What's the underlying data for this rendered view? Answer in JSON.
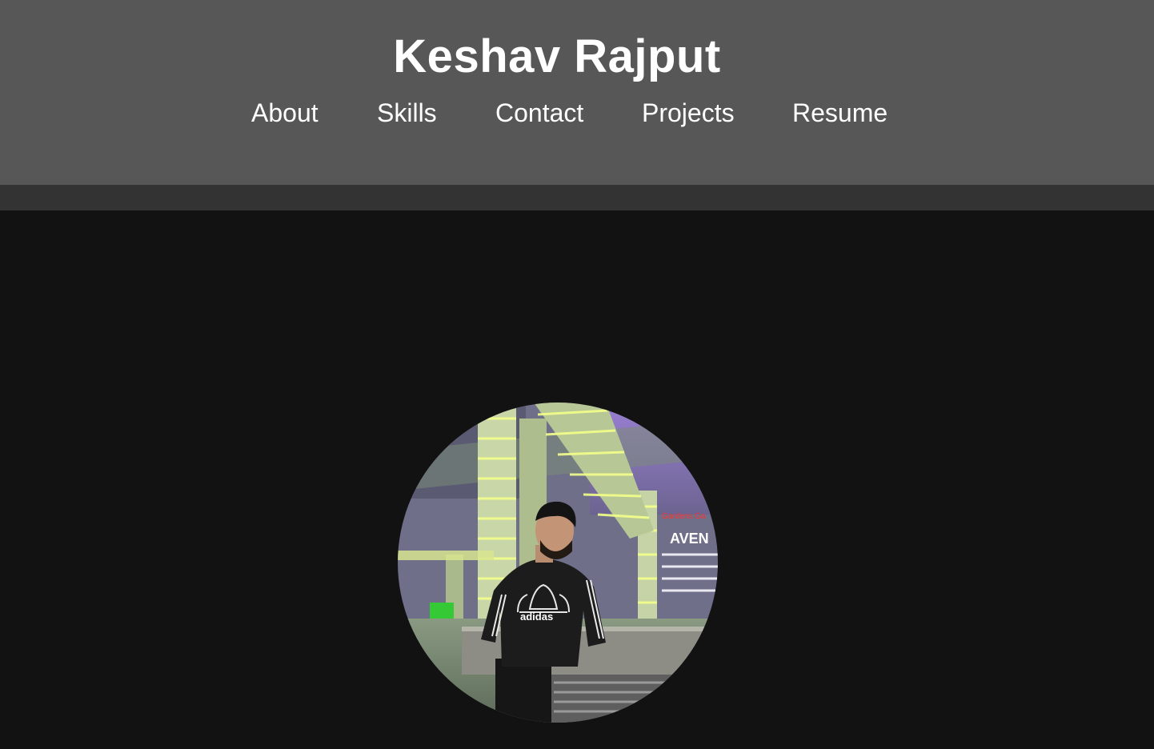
{
  "header": {
    "title": "Keshav Rajput",
    "background": "#575757"
  },
  "nav": {
    "items": [
      {
        "label": "About"
      },
      {
        "label": "Skills"
      },
      {
        "label": "Contact"
      },
      {
        "label": "Projects"
      },
      {
        "label": "Resume"
      }
    ]
  },
  "profile": {
    "photo_text": {
      "hoodie_brand": "adidas",
      "sign": "AVEN",
      "sign_small": "Gardens Ga"
    }
  },
  "colors": {
    "page_background": "#121212",
    "band": "#333333",
    "text": "#ffffff"
  }
}
